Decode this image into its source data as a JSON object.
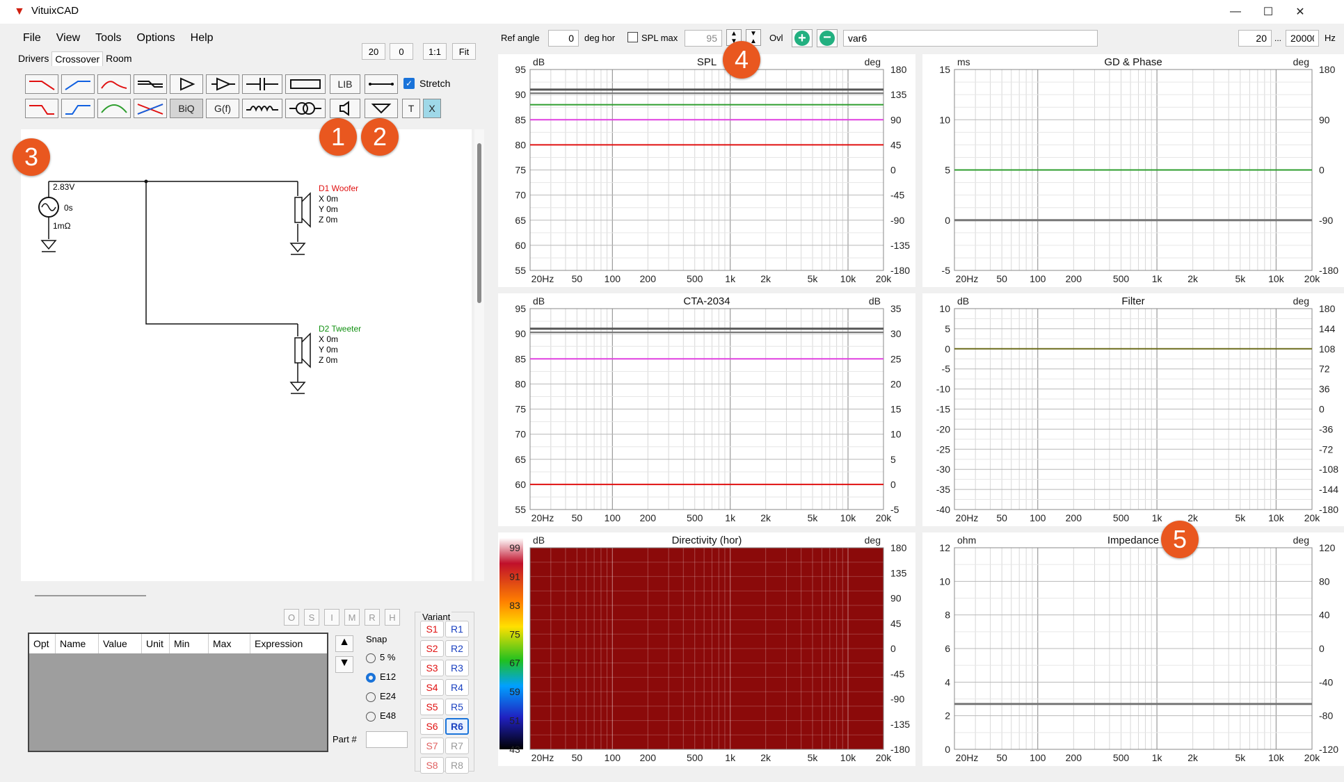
{
  "app": {
    "title": "VituixCAD"
  },
  "window_controls": {
    "minimize": "—",
    "maximize": "☐",
    "close": "✕"
  },
  "menu": [
    "File",
    "View",
    "Tools",
    "Options",
    "Help"
  ],
  "subtabs": [
    "Drivers",
    "Crossover",
    "Room"
  ],
  "zoom": {
    "a": "20",
    "b": "0",
    "c": "1:1",
    "d": "Fit"
  },
  "toolbar": {
    "lib": "LIB",
    "biq": "BiQ",
    "gf": "G(f)",
    "t": "T",
    "x": "X",
    "stretch": "Stretch"
  },
  "header": {
    "ref_angle_label": "Ref angle",
    "ref_angle": "0",
    "deg_hor": "deg hor",
    "spl_max_label": "SPL max",
    "spl_max": "95",
    "ovl": "Ovl",
    "variant_name": "var6",
    "f_min": "20",
    "f_sep": "...",
    "f_max": "20000",
    "f_unit": "Hz"
  },
  "schematic": {
    "source": [
      "2.83V",
      "0s",
      "1mΩ"
    ],
    "drivers": [
      {
        "name": "D1 Woofer",
        "color": "#e01010",
        "pos": [
          "X 0m",
          "Y 0m",
          "Z 0m"
        ]
      },
      {
        "name": "D2 Tweeter",
        "color": "#109010",
        "pos": [
          "X 0m",
          "Y 0m",
          "Z 0m"
        ]
      }
    ]
  },
  "opt_buttons": [
    "O",
    "S",
    "I",
    "M",
    "R",
    "H"
  ],
  "table": {
    "headers": [
      "Opt",
      "Name",
      "Value",
      "Unit",
      "Min",
      "Max",
      "Expression"
    ]
  },
  "snap": {
    "label": "Snap",
    "options": [
      "5 %",
      "E12",
      "E24",
      "E48"
    ],
    "selected": "E12"
  },
  "part": {
    "label": "Part #"
  },
  "variant": {
    "label": "Variant",
    "s": [
      "S1",
      "S2",
      "S3",
      "S4",
      "S5",
      "S6",
      "S7",
      "S8"
    ],
    "r": [
      "R1",
      "R2",
      "R3",
      "R4",
      "R5",
      "R6",
      "R7",
      "R8"
    ],
    "active": "R6"
  },
  "markers": [
    "1",
    "2",
    "3",
    "4",
    "5"
  ],
  "freq_ticks": [
    "20Hz",
    "50",
    "100",
    "200",
    "500",
    "1k",
    "2k",
    "5k",
    "10k",
    "20k"
  ],
  "colors": {
    "accent": "#e9571f",
    "grid": "#d8d8d8",
    "directivity": "#8b0a0a"
  },
  "charts": [
    {
      "id": "spl",
      "title": "SPL",
      "lunit": "dB",
      "runit": "deg",
      "left": [
        "95",
        "90",
        "85",
        "80",
        "75",
        "70",
        "65",
        "60",
        "55"
      ],
      "right": [
        "180",
        "135",
        "90",
        "45",
        "0",
        "-45",
        "-90",
        "-135",
        "-180"
      ],
      "ylim": [
        55,
        95
      ],
      "lines": [
        {
          "y": 91,
          "color": "#555555",
          "w": 3
        },
        {
          "y": 90.3,
          "color": "#777777",
          "w": 2
        },
        {
          "y": 88,
          "color": "#2e9e2e",
          "w": 2
        },
        {
          "y": 85,
          "color": "#e040e0",
          "w": 2
        },
        {
          "y": 80,
          "color": "#e01010",
          "w": 2
        }
      ]
    },
    {
      "id": "gd",
      "title": "GD & Phase",
      "lunit": "ms",
      "runit": "deg",
      "left": [
        "15",
        "10",
        "5",
        "0",
        "-5"
      ],
      "right": [
        "180",
        "90",
        "0",
        "-90",
        "-180"
      ],
      "ylim": [
        -5,
        15
      ],
      "lines": [
        {
          "y": 5,
          "color": "#2e9e2e",
          "w": 2
        },
        {
          "y": 0,
          "color": "#777777",
          "w": 3
        }
      ]
    },
    {
      "id": "cta",
      "title": "CTA-2034",
      "lunit": "dB",
      "runit": "dB",
      "left": [
        "95",
        "90",
        "85",
        "80",
        "75",
        "70",
        "65",
        "60",
        "55"
      ],
      "right": [
        "35",
        "30",
        "25",
        "20",
        "15",
        "10",
        "5",
        "0",
        "-5"
      ],
      "ylim": [
        55,
        95
      ],
      "lines": [
        {
          "y": 91,
          "color": "#555555",
          "w": 3
        },
        {
          "y": 90.3,
          "color": "#777777",
          "w": 2
        },
        {
          "y": 85,
          "color": "#e040e0",
          "w": 2
        },
        {
          "y": 60,
          "color": "#e01010",
          "w": 2
        }
      ]
    },
    {
      "id": "filter",
      "title": "Filter",
      "lunit": "dB",
      "runit": "deg",
      "left": [
        "10",
        "5",
        "0",
        "-5",
        "-10",
        "-15",
        "-20",
        "-25",
        "-30",
        "-35",
        "-40"
      ],
      "right": [
        "180",
        "144",
        "108",
        "72",
        "36",
        "0",
        "-36",
        "-72",
        "-108",
        "-144",
        "-180"
      ],
      "ylim": [
        -40,
        10
      ],
      "lines": [
        {
          "y": 0,
          "color": "#6b6b1a",
          "w": 2
        }
      ]
    },
    {
      "id": "directivity",
      "title": "Directivity (hor)",
      "lunit": "dB",
      "runit": "deg",
      "left": [
        "99",
        "91",
        "83",
        "75",
        "67",
        "59",
        "51",
        "43"
      ],
      "right": [
        "180",
        "135",
        "90",
        "45",
        "0",
        "-45",
        "-90",
        "-135",
        "-180"
      ],
      "ylim": [
        43,
        99
      ],
      "lines": []
    },
    {
      "id": "impedance",
      "title": "Impedance",
      "lunit": "ohm",
      "runit": "deg",
      "left": [
        "12",
        "10",
        "8",
        "6",
        "4",
        "2",
        "0"
      ],
      "right": [
        "120",
        "80",
        "40",
        "0",
        "-40",
        "-80",
        "-120"
      ],
      "ylim": [
        0,
        12
      ],
      "lines": [
        {
          "y": 2.7,
          "color": "#777777",
          "w": 3
        }
      ]
    }
  ]
}
